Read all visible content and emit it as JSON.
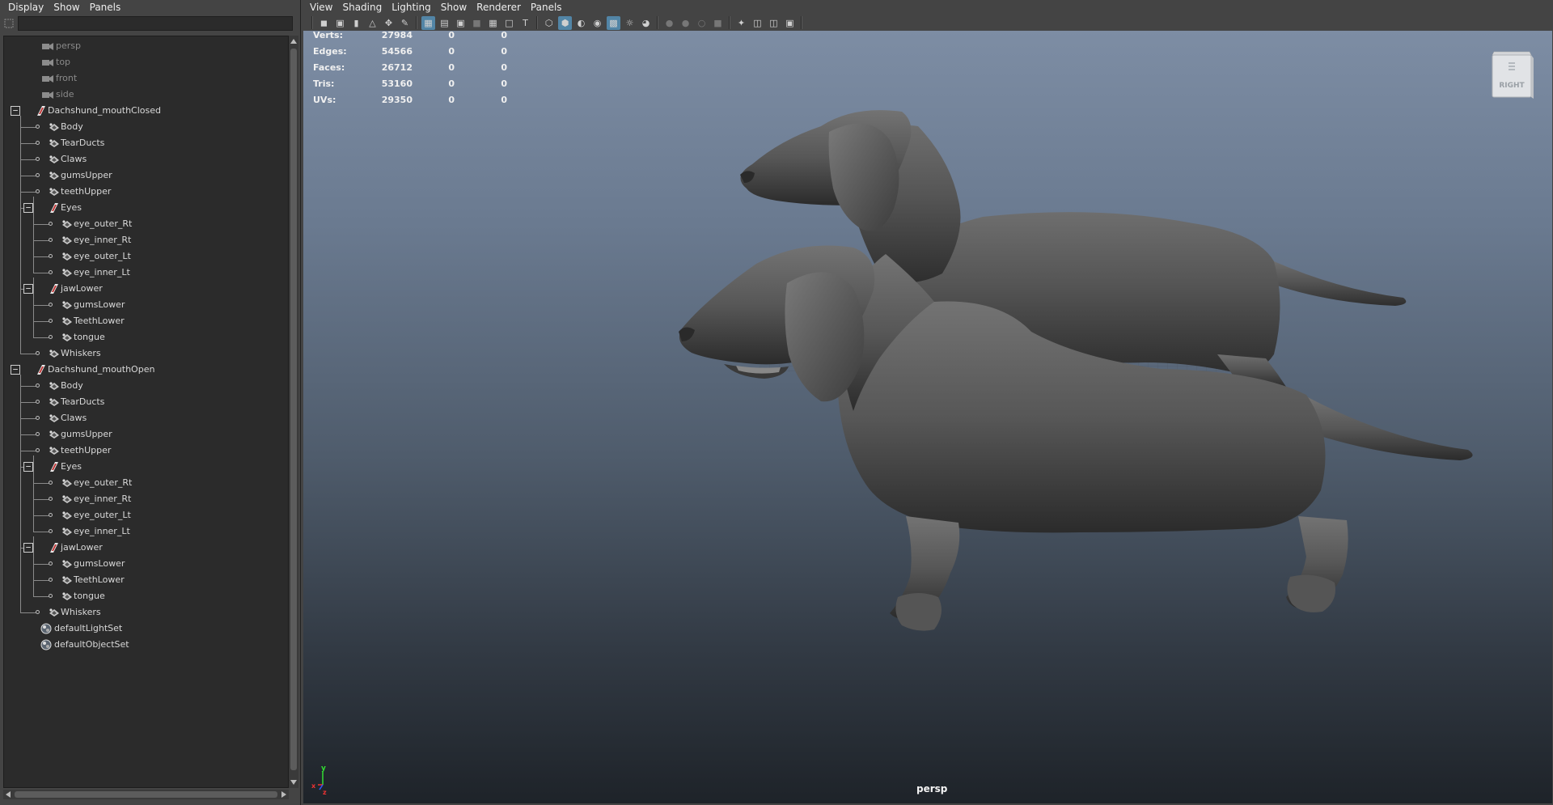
{
  "outliner": {
    "menu": [
      "Display",
      "Show",
      "Panels"
    ],
    "search_placeholder": "",
    "items": [
      {
        "label": "persp",
        "kind": "camera",
        "depth": 0,
        "dim": true
      },
      {
        "label": "top",
        "kind": "camera",
        "depth": 0,
        "dim": true
      },
      {
        "label": "front",
        "kind": "camera",
        "depth": 0,
        "dim": true
      },
      {
        "label": "side",
        "kind": "camera",
        "depth": 0,
        "dim": true
      },
      {
        "label": "Dachshund_mouthClosed",
        "kind": "group",
        "depth": 0,
        "expanded": true
      },
      {
        "label": "Body",
        "kind": "mesh",
        "depth": 1
      },
      {
        "label": "TearDucts",
        "kind": "mesh",
        "depth": 1
      },
      {
        "label": "Claws",
        "kind": "mesh",
        "depth": 1
      },
      {
        "label": "gumsUpper",
        "kind": "mesh",
        "depth": 1
      },
      {
        "label": "teethUpper",
        "kind": "mesh",
        "depth": 1
      },
      {
        "label": "Eyes",
        "kind": "group",
        "depth": 1,
        "expanded": true
      },
      {
        "label": "eye_outer_Rt",
        "kind": "mesh",
        "depth": 2
      },
      {
        "label": "eye_inner_Rt",
        "kind": "mesh",
        "depth": 2
      },
      {
        "label": "eye_outer_Lt",
        "kind": "mesh",
        "depth": 2
      },
      {
        "label": "eye_inner_Lt",
        "kind": "mesh",
        "depth": 2
      },
      {
        "label": "jawLower",
        "kind": "group",
        "depth": 1,
        "expanded": true
      },
      {
        "label": "gumsLower",
        "kind": "mesh",
        "depth": 2
      },
      {
        "label": "TeethLower",
        "kind": "mesh",
        "depth": 2
      },
      {
        "label": "tongue",
        "kind": "mesh",
        "depth": 2
      },
      {
        "label": "Whiskers",
        "kind": "mesh",
        "depth": 1
      },
      {
        "label": "Dachshund_mouthOpen",
        "kind": "group",
        "depth": 0,
        "expanded": true
      },
      {
        "label": "Body",
        "kind": "mesh",
        "depth": 1
      },
      {
        "label": "TearDucts",
        "kind": "mesh",
        "depth": 1
      },
      {
        "label": "Claws",
        "kind": "mesh",
        "depth": 1
      },
      {
        "label": "gumsUpper",
        "kind": "mesh",
        "depth": 1
      },
      {
        "label": "teethUpper",
        "kind": "mesh",
        "depth": 1
      },
      {
        "label": "Eyes",
        "kind": "group",
        "depth": 1,
        "expanded": true
      },
      {
        "label": "eye_outer_Rt",
        "kind": "mesh",
        "depth": 2
      },
      {
        "label": "eye_inner_Rt",
        "kind": "mesh",
        "depth": 2
      },
      {
        "label": "eye_outer_Lt",
        "kind": "mesh",
        "depth": 2
      },
      {
        "label": "eye_inner_Lt",
        "kind": "mesh",
        "depth": 2
      },
      {
        "label": "jawLower",
        "kind": "group",
        "depth": 1,
        "expanded": true
      },
      {
        "label": "gumsLower",
        "kind": "mesh",
        "depth": 2
      },
      {
        "label": "TeethLower",
        "kind": "mesh",
        "depth": 2
      },
      {
        "label": "tongue",
        "kind": "mesh",
        "depth": 2
      },
      {
        "label": "Whiskers",
        "kind": "mesh",
        "depth": 1
      },
      {
        "label": "defaultLightSet",
        "kind": "set",
        "depth": 0
      },
      {
        "label": "defaultObjectSet",
        "kind": "set",
        "depth": 0
      }
    ]
  },
  "viewport": {
    "menu": [
      "View",
      "Shading",
      "Lighting",
      "Show",
      "Renderer",
      "Panels"
    ],
    "hud": [
      {
        "label": "Verts:",
        "values": [
          "27984",
          "0",
          "0"
        ]
      },
      {
        "label": "Edges:",
        "values": [
          "54566",
          "0",
          "0"
        ]
      },
      {
        "label": "Faces:",
        "values": [
          "26712",
          "0",
          "0"
        ]
      },
      {
        "label": "Tris:",
        "values": [
          "53160",
          "0",
          "0"
        ]
      },
      {
        "label": "UVs:",
        "values": [
          "29350",
          "0",
          "0"
        ]
      }
    ],
    "camera_label": "persp",
    "viewcube_label": "RIGHT",
    "axis_labels": {
      "y": "y",
      "x": "x",
      "z": "z"
    },
    "colors": {
      "axis_y": "#33dd33",
      "axis_x": "#ee3333",
      "axis_z": "#3355ff",
      "toolbar_active": "#5285a6"
    }
  }
}
